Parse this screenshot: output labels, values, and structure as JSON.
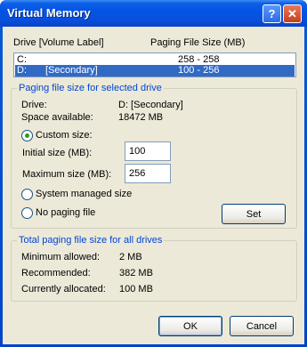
{
  "window": {
    "title": "Virtual Memory",
    "help_glyph": "?",
    "close_glyph": "✕"
  },
  "drive_list": {
    "header_drive": "Drive  [Volume Label]",
    "header_size": "Paging File Size (MB)",
    "rows": [
      {
        "drive": "C:",
        "label": "",
        "size": "258 - 258",
        "selected": false
      },
      {
        "drive": "D:",
        "label": "[Secondary]",
        "size": "100 - 256",
        "selected": true
      }
    ]
  },
  "selected_drive": {
    "group_title": "Paging file size for selected drive",
    "drive_label": "Drive:",
    "drive_value": "D:  [Secondary]",
    "space_label": "Space available:",
    "space_value": "18472 MB",
    "custom_size_label": "Custom size:",
    "initial_label": "Initial size (MB):",
    "initial_value": "100",
    "maximum_label": "Maximum size (MB):",
    "maximum_value": "256",
    "system_managed_label": "System managed size",
    "no_paging_label": "No paging file",
    "selected_option": "custom",
    "set_button": "Set"
  },
  "totals": {
    "group_title": "Total paging file size for all drives",
    "minimum_label": "Minimum allowed:",
    "minimum_value": "2 MB",
    "recommended_label": "Recommended:",
    "recommended_value": "382 MB",
    "allocated_label": "Currently allocated:",
    "allocated_value": "100 MB"
  },
  "buttons": {
    "ok": "OK",
    "cancel": "Cancel"
  }
}
